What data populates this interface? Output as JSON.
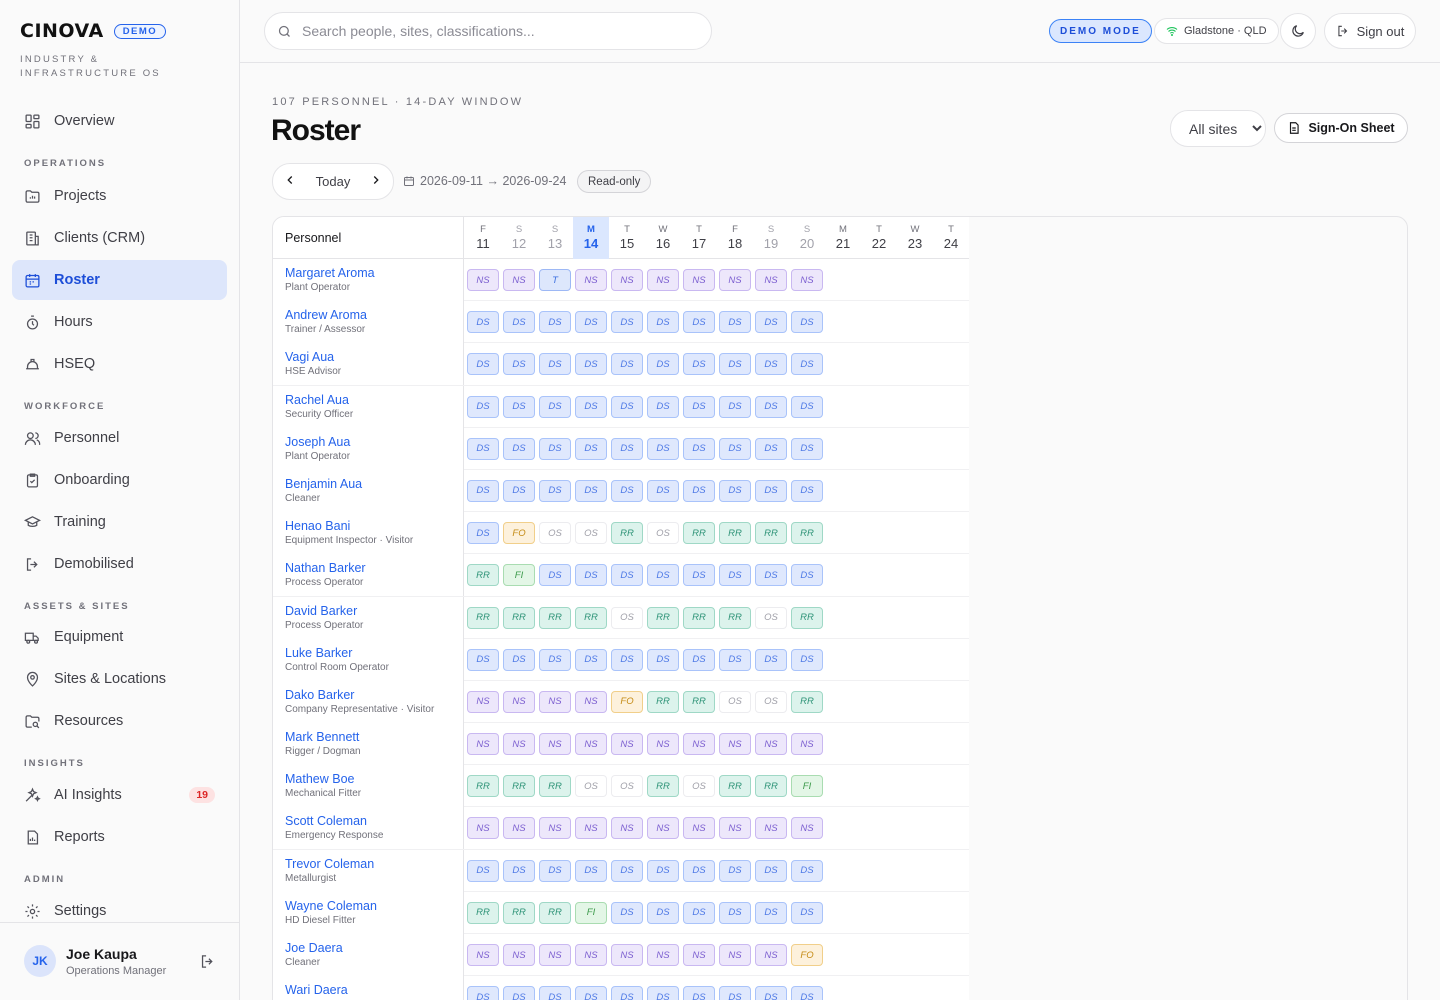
{
  "brand": {
    "name": "CINOVA",
    "badge": "DEMO",
    "tagline": "INDUSTRY & INFRASTRUCTURE OS"
  },
  "nav": {
    "overview": "Overview",
    "sec_operations": "OPERATIONS",
    "projects": "Projects",
    "clients": "Clients (CRM)",
    "roster": "Roster",
    "hours": "Hours",
    "hseq": "HSEQ",
    "sec_workforce": "WORKFORCE",
    "personnel": "Personnel",
    "onboarding": "Onboarding",
    "training": "Training",
    "demobilised": "Demobilised",
    "sec_assets": "ASSETS & SITES",
    "equipment": "Equipment",
    "sites": "Sites & Locations",
    "resources": "Resources",
    "sec_insights": "INSIGHTS",
    "ai_insights": "AI Insights",
    "ai_insights_count": "19",
    "reports": "Reports",
    "sec_admin": "ADMIN",
    "settings": "Settings"
  },
  "user": {
    "initials": "JK",
    "name": "Joe Kaupa",
    "role": "Operations Manager"
  },
  "topbar": {
    "search_placeholder": "Search people, sites, classifications...",
    "demo_mode": "DEMO MODE",
    "location": "Gladstone · QLD",
    "signout": "Sign out"
  },
  "page": {
    "eyebrow": "107 PERSONNEL · 14-DAY WINDOW",
    "title": "Roster",
    "site_filter": "All sites",
    "signon_label": "Sign-On Sheet",
    "today_label": "Today",
    "date_range": "2026-09-11 → 2026-09-24",
    "readonly": "Read-only"
  },
  "grid": {
    "personnel_header": "Personnel",
    "days": [
      {
        "dow": "F",
        "num": "11",
        "type": "normal"
      },
      {
        "dow": "S",
        "num": "12",
        "type": "weekend"
      },
      {
        "dow": "S",
        "num": "13",
        "type": "weekend"
      },
      {
        "dow": "M",
        "num": "14",
        "type": "today"
      },
      {
        "dow": "T",
        "num": "15",
        "type": "normal"
      },
      {
        "dow": "W",
        "num": "16",
        "type": "normal"
      },
      {
        "dow": "T",
        "num": "17",
        "type": "normal"
      },
      {
        "dow": "F",
        "num": "18",
        "type": "normal"
      },
      {
        "dow": "S",
        "num": "19",
        "type": "weekend"
      },
      {
        "dow": "S",
        "num": "20",
        "type": "weekend"
      },
      {
        "dow": "M",
        "num": "21",
        "type": "normal"
      },
      {
        "dow": "T",
        "num": "22",
        "type": "normal"
      },
      {
        "dow": "W",
        "num": "23",
        "type": "normal"
      },
      {
        "dow": "T",
        "num": "24",
        "type": "normal"
      }
    ],
    "rows": [
      {
        "name": "Margaret Aroma",
        "role": "Plant Operator",
        "shifts": [
          "NS",
          "NS",
          "T",
          "NS",
          "NS",
          "NS",
          "NS",
          "NS",
          "NS",
          "NS"
        ]
      },
      {
        "name": "Andrew Aroma",
        "role": "Trainer / Assessor",
        "shifts": [
          "DS",
          "DS",
          "DS",
          "DS",
          "DS",
          "DS",
          "DS",
          "DS",
          "DS",
          "DS"
        ]
      },
      {
        "name": "Vagi Aua",
        "role": "HSE Advisor",
        "shifts": [
          "DS",
          "DS",
          "DS",
          "DS",
          "DS",
          "DS",
          "DS",
          "DS",
          "DS",
          "DS"
        ]
      },
      {
        "name": "Rachel Aua",
        "role": "Security Officer",
        "shifts": [
          "DS",
          "DS",
          "DS",
          "DS",
          "DS",
          "DS",
          "DS",
          "DS",
          "DS",
          "DS"
        ]
      },
      {
        "name": "Joseph Aua",
        "role": "Plant Operator",
        "shifts": [
          "DS",
          "DS",
          "DS",
          "DS",
          "DS",
          "DS",
          "DS",
          "DS",
          "DS",
          "DS"
        ]
      },
      {
        "name": "Benjamin Aua",
        "role": "Cleaner",
        "shifts": [
          "DS",
          "DS",
          "DS",
          "DS",
          "DS",
          "DS",
          "DS",
          "DS",
          "DS",
          "DS"
        ]
      },
      {
        "name": "Henao Bani",
        "role": "Equipment Inspector · Visitor",
        "shifts": [
          "DS",
          "FO",
          "OS",
          "OS",
          "RR",
          "OS",
          "RR",
          "RR",
          "RR",
          "RR"
        ]
      },
      {
        "name": "Nathan Barker",
        "role": "Process Operator",
        "shifts": [
          "RR",
          "FI",
          "DS",
          "DS",
          "DS",
          "DS",
          "DS",
          "DS",
          "DS",
          "DS"
        ]
      },
      {
        "name": "David Barker",
        "role": "Process Operator",
        "shifts": [
          "RR",
          "RR",
          "RR",
          "RR",
          "OS",
          "RR",
          "RR",
          "RR",
          "OS",
          "RR"
        ]
      },
      {
        "name": "Luke Barker",
        "role": "Control Room Operator",
        "shifts": [
          "DS",
          "DS",
          "DS",
          "DS",
          "DS",
          "DS",
          "DS",
          "DS",
          "DS",
          "DS"
        ]
      },
      {
        "name": "Dako Barker",
        "role": "Company Representative · Visitor",
        "shifts": [
          "NS",
          "NS",
          "NS",
          "NS",
          "FO",
          "RR",
          "RR",
          "OS",
          "OS",
          "RR"
        ]
      },
      {
        "name": "Mark Bennett",
        "role": "Rigger / Dogman",
        "shifts": [
          "NS",
          "NS",
          "NS",
          "NS",
          "NS",
          "NS",
          "NS",
          "NS",
          "NS",
          "NS"
        ]
      },
      {
        "name": "Mathew Boe",
        "role": "Mechanical Fitter",
        "shifts": [
          "RR",
          "RR",
          "RR",
          "OS",
          "OS",
          "RR",
          "OS",
          "RR",
          "RR",
          "FI"
        ]
      },
      {
        "name": "Scott Coleman",
        "role": "Emergency Response",
        "shifts": [
          "NS",
          "NS",
          "NS",
          "NS",
          "NS",
          "NS",
          "NS",
          "NS",
          "NS",
          "NS"
        ]
      },
      {
        "name": "Trevor Coleman",
        "role": "Metallurgist",
        "shifts": [
          "DS",
          "DS",
          "DS",
          "DS",
          "DS",
          "DS",
          "DS",
          "DS",
          "DS",
          "DS"
        ]
      },
      {
        "name": "Wayne Coleman",
        "role": "HD Diesel Fitter",
        "shifts": [
          "RR",
          "RR",
          "RR",
          "FI",
          "DS",
          "DS",
          "DS",
          "DS",
          "DS",
          "DS"
        ]
      },
      {
        "name": "Joe Daera",
        "role": "Cleaner",
        "shifts": [
          "NS",
          "NS",
          "NS",
          "NS",
          "NS",
          "NS",
          "NS",
          "NS",
          "NS",
          "FO"
        ]
      },
      {
        "name": "Wari Daera",
        "role": "",
        "shifts": [
          "DS",
          "DS",
          "DS",
          "DS",
          "DS",
          "DS",
          "DS",
          "DS",
          "DS",
          "DS"
        ]
      }
    ]
  }
}
